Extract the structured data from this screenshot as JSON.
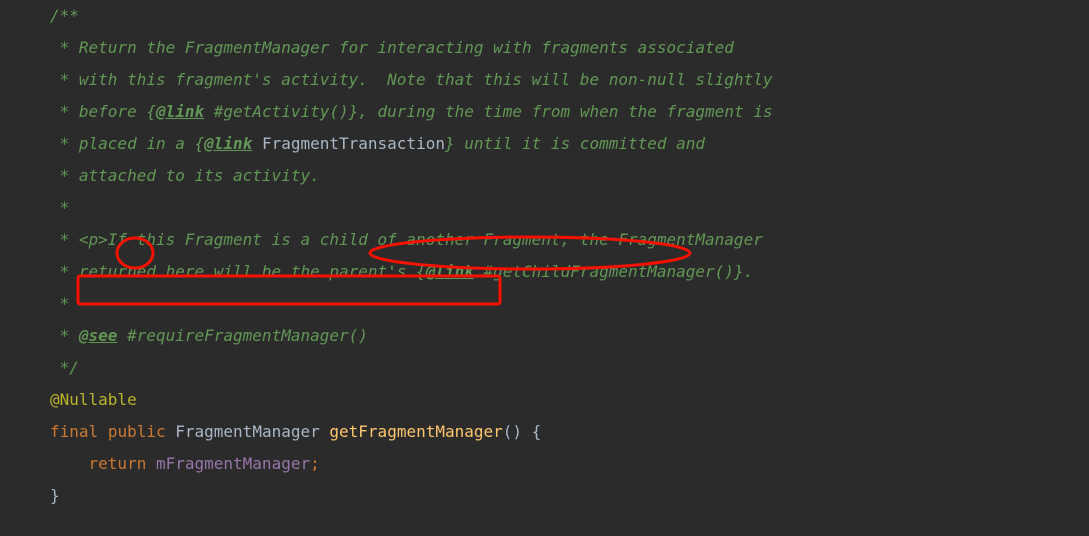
{
  "code": {
    "l1": "/**",
    "l2a": " * Return the FragmentManager for interacting with fragments associated",
    "l3a": " * with this fragment's activity.  Note that this will be non-null slightly",
    "l4a": " * before {",
    "l4tag": "@link",
    "l4b": " #getActivity()}, during the time from when the fragment is",
    "l5a": " * placed in a {",
    "l5tag": "@link",
    "l5b": " ",
    "l5c": "FragmentTransaction",
    "l5d": "} until it is committed and",
    "l6a": " * attached to its activity.",
    "l7": " *",
    "l8a": " * <p>If this Fragment is a child of another Fragment, the FragmentManager",
    "l9a": " * returned here will be the parent's {",
    "l9tag": "@link",
    "l9b": " #getChildFragmentManager()}.",
    "l10": " *",
    "l11a": " * ",
    "l11tag": "@see",
    "l11b": " #requireFragmentManager()",
    "l12": " */",
    "ann": "@Nullable",
    "kw_final": "final",
    "kw_public": "public",
    "ret_type": "FragmentManager",
    "method": "getFragmentManager",
    "paren_open": "() {",
    "kw_return": "return",
    "field": "mFragmentManager",
    "semi": ";",
    "close": "}"
  },
  "annotations": [
    {
      "type": "circle-small",
      "desc": "around letter 'If'"
    },
    {
      "type": "ellipse-wide",
      "desc": "around 'child of another Fragment'"
    },
    {
      "type": "rect",
      "desc": "around 'returned here will be the parent's'"
    }
  ]
}
